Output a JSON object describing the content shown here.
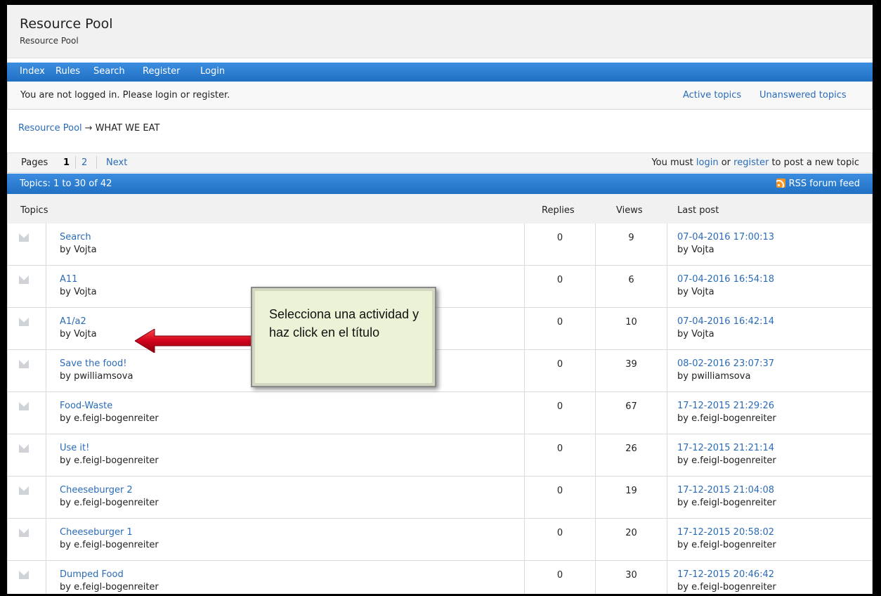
{
  "brand": {
    "title": "Resource Pool",
    "description": "Resource Pool"
  },
  "nav": {
    "items": [
      "Index",
      "Rules",
      "Search",
      "Register",
      "Login"
    ]
  },
  "status": {
    "message": "You are not logged in. Please login or register.",
    "links": [
      "Active topics",
      "Unanswered topics"
    ]
  },
  "breadcrumb": {
    "home": "Resource Pool",
    "separator": "→",
    "current": "WHAT WE EAT"
  },
  "pager": {
    "label": "Pages",
    "current": "1",
    "other": "2",
    "next": "Next",
    "notice_prefix": "You must",
    "notice_login": "login",
    "notice_or": "or",
    "notice_register": "register",
    "notice_suffix": "to post a new topic"
  },
  "table": {
    "count_label": "Topics: 1 to 30 of 42",
    "rss_label": "RSS forum feed",
    "headers": {
      "topics": "Topics",
      "replies": "Replies",
      "views": "Views",
      "last_post": "Last post"
    },
    "rows": [
      {
        "title": "Search",
        "by": "by Vojta",
        "replies": "0",
        "views": "9",
        "last_date": "07-04-2016 17:00:13",
        "last_by": "by Vojta"
      },
      {
        "title": "A11",
        "by": "by Vojta",
        "replies": "0",
        "views": "6",
        "last_date": "07-04-2016 16:54:18",
        "last_by": "by Vojta"
      },
      {
        "title": "A1/a2",
        "by": "by Vojta",
        "replies": "0",
        "views": "10",
        "last_date": "07-04-2016 16:42:14",
        "last_by": "by Vojta"
      },
      {
        "title": "Save the food!",
        "by": "by pwilliamsova",
        "replies": "0",
        "views": "39",
        "last_date": "08-02-2016 23:07:37",
        "last_by": "by pwilliamsova"
      },
      {
        "title": "Food-Waste",
        "by": "by e.feigl-bogenreiter",
        "replies": "0",
        "views": "67",
        "last_date": "17-12-2015 21:29:26",
        "last_by": "by e.feigl-bogenreiter"
      },
      {
        "title": "Use it!",
        "by": "by e.feigl-bogenreiter",
        "replies": "0",
        "views": "26",
        "last_date": "17-12-2015 21:21:14",
        "last_by": "by e.feigl-bogenreiter"
      },
      {
        "title": "Cheeseburger 2",
        "by": "by e.feigl-bogenreiter",
        "replies": "0",
        "views": "19",
        "last_date": "17-12-2015 21:04:08",
        "last_by": "by e.feigl-bogenreiter"
      },
      {
        "title": "Cheeseburger 1",
        "by": "by e.feigl-bogenreiter",
        "replies": "0",
        "views": "20",
        "last_date": "17-12-2015 20:58:02",
        "last_by": "by e.feigl-bogenreiter"
      },
      {
        "title": "Dumped Food",
        "by": "by e.feigl-bogenreiter",
        "replies": "0",
        "views": "30",
        "last_date": "17-12-2015 20:46:42",
        "last_by": "by e.feigl-bogenreiter"
      }
    ]
  },
  "callout": {
    "text": "Selecciona una actividad y haz click en el título"
  },
  "colors": {
    "nav_blue": "#2a7fd4",
    "link_blue": "#2a6bb8",
    "callout_bg": "#ebf2d6",
    "arrow_red": "#d0021b",
    "rss_orange": "#f7931e"
  }
}
